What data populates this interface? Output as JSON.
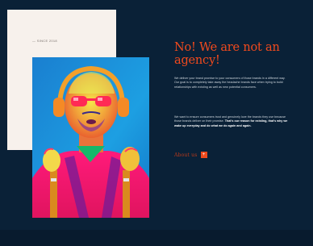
{
  "card": {
    "label": "— SINCE 2018"
  },
  "hero": {
    "alt": "Pop-art portrait of a man with headphones and sunglasses"
  },
  "headline": "No! We are not an agency!",
  "paragraphs": {
    "first": "We deliver your brand promise to your consumers of those brands in a different way. Our goal is to completely take away the headache brands face when trying to build relationships with existing as well as new potential consumers.",
    "second_plain": "We want to ensure consumers trust and genuinely love the brands they use because those brands deliver on their promise. ",
    "second_bold": "That's our reason for existing, that's why we wake up everyday and do what we do again and again."
  },
  "cta": {
    "label": "About us",
    "icon": "plus-icon",
    "icon_glyph": "+"
  },
  "colors": {
    "background": "#0a2137",
    "card": "#f7f1ec",
    "accent": "#f24a1d",
    "body_text": "#ced6dd"
  }
}
